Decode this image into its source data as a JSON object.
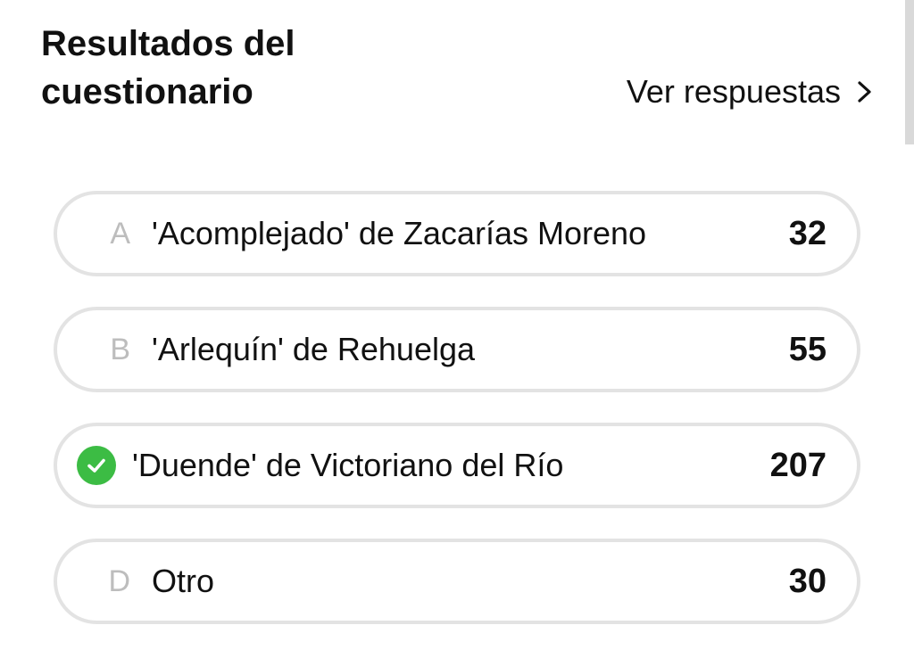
{
  "header": {
    "title": "Resultados del cuestionario",
    "see_answers_label": "Ver respuestas",
    "see_answers_icon": "chevron-right-icon"
  },
  "options": [
    {
      "letter": "A",
      "text": "'Acomplejado' de Zacarías Moreno",
      "count": "32",
      "correct": false
    },
    {
      "letter": "B",
      "text": "'Arlequín' de Rehuelga",
      "count": "55",
      "correct": false
    },
    {
      "letter": "",
      "text": "'Duende' de Victoriano del Río",
      "count": "207",
      "correct": true,
      "icon": "check-circle-icon"
    },
    {
      "letter": "D",
      "text": "Otro",
      "count": "30",
      "correct": false
    }
  ],
  "colors": {
    "correct_green": "#3cbc44",
    "border": "#e3e3e3",
    "letter": "#bdbdbd"
  }
}
